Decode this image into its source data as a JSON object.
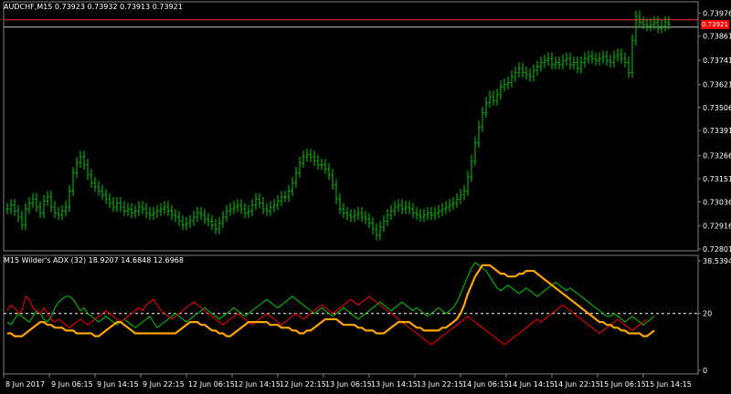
{
  "price_panel": {
    "title": "AUDCHF,M15  0.73923 0.73932 0.73913 0.73921",
    "current_price_tag": "0.73921",
    "colors": {
      "bars": "#00cc00",
      "grid": "#808080",
      "text": "#ffffff",
      "bid_line": "#ff3030",
      "ask_line": "#c0c0c0",
      "price_tag": "#ff0000"
    }
  },
  "indicator_panel": {
    "title": "M15 Wilder's  ADX (32) 18.9207 14.6848 12.6968",
    "level_label": "20",
    "colors": {
      "plus_di": "#00cc00",
      "minus_di": "#ff0000",
      "adx": "#ffa500",
      "level_line": "#ffffff"
    }
  },
  "chart_data": [
    {
      "type": "bar",
      "title": "AUDCHF,M15  0.73923 0.73932 0.73913 0.73921",
      "xlabel": "",
      "ylabel": "",
      "ylim": [
        0.72801,
        0.73987
      ],
      "y_ticks": [
        "0.73976",
        "0.73861",
        "0.73741",
        "0.73621",
        "0.73506",
        "0.73391",
        "0.73266",
        "0.73151",
        "0.73036",
        "0.72916",
        "0.72801"
      ],
      "x_ticks": [
        "8 Jun 2017",
        "9 Jun 06:15",
        "9 Jun 14:15",
        "9 Jun 22:15",
        "12 Jun 06:15",
        "12 Jun 14:15",
        "12 Jun 22:15",
        "13 Jun 06:15",
        "13 Jun 14:15",
        "13 Jun 22:15",
        "14 Jun 06:15",
        "14 Jun 14:15",
        "14 Jun 22:15",
        "15 Jun 06:15",
        "15 Jun 14:15"
      ],
      "x": [
        0,
        2,
        4,
        6,
        8,
        10,
        12,
        14,
        16,
        18,
        20,
        22,
        24,
        26,
        28,
        30,
        32,
        34,
        36,
        38,
        40,
        42,
        44,
        46,
        48,
        50,
        52,
        54,
        56,
        58,
        60,
        62,
        64,
        66,
        68,
        70,
        72,
        74,
        76,
        78,
        80,
        82,
        84,
        86,
        88,
        90,
        92,
        94,
        96,
        98,
        100,
        102,
        104,
        106,
        108,
        110,
        112,
        114,
        116,
        118,
        120,
        122,
        124,
        126,
        128,
        130,
        132,
        134,
        136,
        138,
        140,
        142,
        144,
        146,
        148,
        150,
        152,
        154,
        156,
        158,
        160,
        162,
        164,
        166,
        168,
        170,
        172,
        174,
        176,
        178,
        180,
        182,
        184,
        186,
        188,
        190,
        192,
        194,
        196,
        198,
        200,
        202,
        204,
        206,
        208,
        210,
        212,
        214,
        216,
        218,
        220,
        222,
        224,
        226,
        228,
        230,
        232,
        234,
        236,
        238,
        240,
        242,
        244,
        246,
        248,
        250,
        252,
        254,
        256,
        258,
        260,
        262,
        264,
        266,
        268,
        270,
        272,
        274,
        276,
        278,
        280,
        282,
        284,
        286,
        288,
        290,
        292,
        294,
        296,
        298,
        300,
        302,
        304,
        306,
        308,
        310,
        312,
        314,
        316,
        318,
        320,
        322,
        324,
        326,
        328,
        330,
        332,
        334,
        336,
        338,
        340,
        342,
        344,
        346,
        348,
        350,
        352,
        354,
        356,
        358,
        360,
        362,
        364,
        366,
        368,
        370,
        372
      ],
      "series": [
        {
          "values": [
            0.73,
            0.7302,
            0.7299,
            0.7296,
            0.7292,
            0.73,
            0.7303,
            0.7305,
            0.7301,
            0.7298,
            0.7304,
            0.7306,
            0.7301,
            0.7298,
            0.7297,
            0.7299,
            0.7301,
            0.7309,
            0.7318,
            0.7323,
            0.7326,
            0.7322,
            0.7317,
            0.7313,
            0.7311,
            0.7309,
            0.7307,
            0.7305,
            0.7303,
            0.7301,
            0.7303,
            0.7301,
            0.7299,
            0.73,
            0.7298,
            0.7299,
            0.7301,
            0.73,
            0.7298,
            0.7297,
            0.7298,
            0.7299,
            0.73,
            0.7301,
            0.7299,
            0.7297,
            0.7296,
            0.7294,
            0.7292,
            0.7293,
            0.7294,
            0.7296,
            0.7298,
            0.7297,
            0.7295,
            0.7294,
            0.7292,
            0.729,
            0.7293,
            0.7296,
            0.7299,
            0.73,
            0.7301,
            0.7302,
            0.73,
            0.7298,
            0.7299,
            0.7302,
            0.7305,
            0.7303,
            0.73,
            0.7299,
            0.7301,
            0.7302,
            0.7304,
            0.7306,
            0.7306,
            0.7309,
            0.7313,
            0.7318,
            0.7323,
            0.7326,
            0.7327,
            0.7326,
            0.7324,
            0.7322,
            0.7322,
            0.732,
            0.7317,
            0.7312,
            0.7305,
            0.73,
            0.7298,
            0.7297,
            0.7296,
            0.7297,
            0.7298,
            0.7296,
            0.7295,
            0.7293,
            0.729,
            0.7287,
            0.7291,
            0.7294,
            0.7297,
            0.7299,
            0.7301,
            0.7302,
            0.73,
            0.7301,
            0.73,
            0.7298,
            0.7297,
            0.7296,
            0.7297,
            0.7298,
            0.7297,
            0.7298,
            0.7299,
            0.73,
            0.7301,
            0.7302,
            0.7303,
            0.7305,
            0.7307,
            0.7309,
            0.7316,
            0.7324,
            0.7333,
            0.7341,
            0.7348,
            0.7353,
            0.7356,
            0.7354,
            0.7357,
            0.7361,
            0.7362,
            0.7363,
            0.7366,
            0.7368,
            0.737,
            0.7368,
            0.7367,
            0.7366,
            0.7369,
            0.7371,
            0.7373,
            0.7374,
            0.7375,
            0.7372,
            0.7373,
            0.7372,
            0.7374,
            0.7375,
            0.7372,
            0.7373,
            0.737,
            0.7373,
            0.7375,
            0.7376,
            0.7375,
            0.7374,
            0.7375,
            0.7376,
            0.7374,
            0.7373,
            0.7376,
            0.7377,
            0.7375,
            0.7373,
            0.7368,
            0.7384,
            0.7396,
            0.7393,
            0.7392,
            0.7391,
            0.7392,
            0.7393,
            0.739,
            0.7391,
            0.7393,
            0.7392
          ]
        }
      ]
    },
    {
      "type": "line",
      "title": "M15 Wilder's  ADX (32) 18.9207 14.6848 12.6968",
      "xlabel": "",
      "ylabel": "",
      "ylim": [
        0,
        38.5394
      ],
      "y_ticks": [
        "38.5394",
        "20",
        "0"
      ],
      "reference_level": 20,
      "x": [
        0,
        2,
        4,
        6,
        8,
        10,
        12,
        14,
        16,
        18,
        20,
        22,
        24,
        26,
        28,
        30,
        32,
        34,
        36,
        38,
        40,
        42,
        44,
        46,
        48,
        50,
        52,
        54,
        56,
        58,
        60,
        62,
        64,
        66,
        68,
        70,
        72,
        74,
        76,
        78,
        80,
        82,
        84,
        86,
        88,
        90,
        92,
        94,
        96,
        98,
        100,
        102,
        104,
        106,
        108,
        110,
        112,
        114,
        116,
        118,
        120,
        122,
        124,
        126,
        128,
        130,
        132,
        134,
        136,
        138,
        140,
        142,
        144,
        146,
        148,
        150,
        152,
        154,
        156,
        158,
        160,
        162,
        164,
        166,
        168,
        170,
        172,
        174,
        176,
        178,
        180,
        182,
        184,
        186,
        188,
        190,
        192,
        194,
        196,
        198,
        200,
        202,
        204,
        206,
        208,
        210,
        212,
        214,
        216,
        218,
        220,
        222,
        224,
        226,
        228,
        230,
        232,
        234,
        236,
        238,
        240,
        242,
        244,
        246,
        248,
        250,
        252,
        254,
        256,
        258,
        260,
        262,
        264,
        266,
        268,
        270,
        272,
        274,
        276,
        278,
        280,
        282,
        284,
        286,
        288,
        290,
        292,
        294,
        296,
        298,
        300,
        302,
        304,
        306,
        308,
        310,
        312,
        314,
        316,
        318,
        320,
        322,
        324,
        326,
        328,
        330,
        332,
        334,
        336,
        338,
        340,
        342,
        344,
        346,
        348,
        350,
        352,
        354,
        356,
        358,
        360,
        362,
        364,
        366,
        368,
        370,
        372
      ],
      "series": [
        {
          "values": [
            17,
            16,
            18,
            20,
            19,
            18,
            17,
            19,
            21,
            20,
            18,
            17,
            19,
            22,
            24,
            25,
            26,
            26,
            25,
            23,
            21,
            22,
            20,
            19,
            18,
            17,
            18,
            19,
            18,
            17,
            16,
            17,
            18,
            17,
            16,
            15,
            16,
            17,
            18,
            19,
            17,
            15,
            16,
            17,
            18,
            19,
            20,
            19,
            18,
            17,
            18,
            19,
            20,
            21,
            22,
            21,
            20,
            19,
            18,
            19,
            20,
            21,
            22,
            21,
            20,
            19,
            20,
            21,
            22,
            23,
            24,
            25,
            24,
            23,
            22,
            23,
            24,
            25,
            26,
            25,
            24,
            23,
            22,
            21,
            20,
            21,
            22,
            21,
            20,
            19,
            20,
            21,
            22,
            21,
            20,
            19,
            18,
            19,
            20,
            21,
            22,
            23,
            24,
            23,
            22,
            21,
            22,
            23,
            24,
            23,
            22,
            21,
            22,
            21,
            20,
            19,
            20,
            21,
            22,
            21,
            20,
            21,
            22,
            24,
            27,
            30,
            33,
            36,
            38,
            37,
            36,
            35,
            33,
            31,
            29,
            28,
            29,
            30,
            29,
            28,
            27,
            28,
            29,
            28,
            27,
            26,
            27,
            28,
            29,
            30,
            31,
            30,
            29,
            28,
            29,
            28,
            27,
            26,
            25,
            24,
            23,
            22,
            21,
            20,
            19,
            19,
            20,
            19,
            18,
            17,
            18,
            19,
            18,
            17,
            16,
            17,
            18,
            19
          ]
        },
        {
          "values": [
            21,
            23,
            22,
            20,
            21,
            26,
            25,
            22,
            21,
            20,
            22,
            20,
            18,
            17,
            18,
            17,
            16,
            15,
            16,
            17,
            18,
            17,
            16,
            17,
            18,
            19,
            20,
            21,
            20,
            19,
            18,
            17,
            18,
            19,
            20,
            21,
            22,
            21,
            23,
            24,
            25,
            23,
            21,
            20,
            19,
            18,
            19,
            20,
            21,
            22,
            23,
            24,
            23,
            22,
            21,
            20,
            19,
            18,
            17,
            16,
            17,
            18,
            19,
            20,
            19,
            18,
            17,
            16,
            17,
            18,
            19,
            20,
            19,
            18,
            17,
            16,
            17,
            18,
            19,
            20,
            19,
            18,
            19,
            20,
            21,
            22,
            23,
            22,
            21,
            20,
            21,
            22,
            23,
            24,
            25,
            24,
            23,
            24,
            25,
            26,
            25,
            24,
            23,
            22,
            21,
            20,
            19,
            18,
            17,
            16,
            15,
            14,
            13,
            12,
            11,
            10,
            9,
            10,
            11,
            12,
            13,
            14,
            15,
            16,
            17,
            18,
            19,
            18,
            17,
            16,
            15,
            14,
            13,
            12,
            11,
            10,
            9,
            10,
            11,
            12,
            13,
            14,
            15,
            16,
            17,
            18,
            17,
            18,
            19,
            20,
            21,
            22,
            23,
            22,
            21,
            20,
            19,
            18,
            17,
            16,
            15,
            14,
            13,
            14,
            15,
            16,
            17,
            18,
            17,
            16,
            15,
            14,
            15,
            16,
            17,
            18
          ]
        },
        {
          "values": [
            13,
            13,
            12,
            12,
            12,
            13,
            14,
            15,
            16,
            17,
            17,
            16,
            16,
            15,
            15,
            15,
            14,
            14,
            14,
            13,
            13,
            13,
            13,
            13,
            12,
            12,
            13,
            14,
            15,
            16,
            17,
            17,
            16,
            15,
            14,
            13,
            13,
            13,
            13,
            13,
            13,
            13,
            13,
            13,
            13,
            13,
            13,
            14,
            15,
            16,
            17,
            17,
            17,
            16,
            16,
            15,
            14,
            14,
            13,
            13,
            12,
            12,
            13,
            14,
            15,
            16,
            17,
            17,
            17,
            17,
            17,
            17,
            16,
            16,
            16,
            15,
            15,
            15,
            14,
            14,
            13,
            13,
            14,
            14,
            15,
            16,
            17,
            18,
            18,
            18,
            18,
            17,
            16,
            16,
            16,
            16,
            15,
            15,
            14,
            14,
            14,
            13,
            13,
            13,
            14,
            15,
            16,
            17,
            17,
            17,
            17,
            16,
            15,
            15,
            14,
            14,
            14,
            14,
            14,
            15,
            15,
            16,
            17,
            18,
            20,
            23,
            27,
            30,
            33,
            35,
            37,
            37,
            37,
            36,
            35,
            34,
            34,
            33,
            33,
            33,
            34,
            34,
            35,
            35,
            35,
            34,
            33,
            32,
            31,
            30,
            29,
            28,
            27,
            26,
            25,
            24,
            23,
            22,
            21,
            20,
            19,
            18,
            17,
            17,
            16,
            16,
            15,
            15,
            14,
            14,
            13,
            13,
            13,
            13,
            12,
            12,
            13,
            14
          ]
        }
      ]
    }
  ]
}
